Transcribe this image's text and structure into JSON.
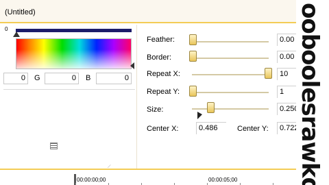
{
  "window": {
    "title": "(Untitled)"
  },
  "gradient": {
    "left_value": "0",
    "bar_color": "#1c1c6a"
  },
  "rgb": {
    "r_value": "0",
    "g_label": "G",
    "g_value": "0",
    "b_label": "B",
    "b_value": "0"
  },
  "params": {
    "feather": {
      "label": "Feather:",
      "value": "0.00",
      "slider": 0.0
    },
    "border": {
      "label": "Border:",
      "value": "0.00",
      "slider": 0.0
    },
    "repeat_x": {
      "label": "Repeat X:",
      "value": "10",
      "slider": 1.0
    },
    "repeat_y": {
      "label": "Repeat Y:",
      "value": "1",
      "slider": 0.0
    },
    "size": {
      "label": "Size:",
      "value": "0.250",
      "slider": 0.25
    }
  },
  "center": {
    "x_label": "Center X:",
    "x_value": "0.486",
    "y_label": "Center Y:",
    "y_value": "0.722"
  },
  "timeline": {
    "start": "00:00:00;00",
    "mark": "00:00:05;00"
  },
  "watermark": {
    "text": "ooboolesrawkd"
  },
  "colors": {
    "accent": "#f3cc55",
    "thumb": "#e9c55a"
  }
}
